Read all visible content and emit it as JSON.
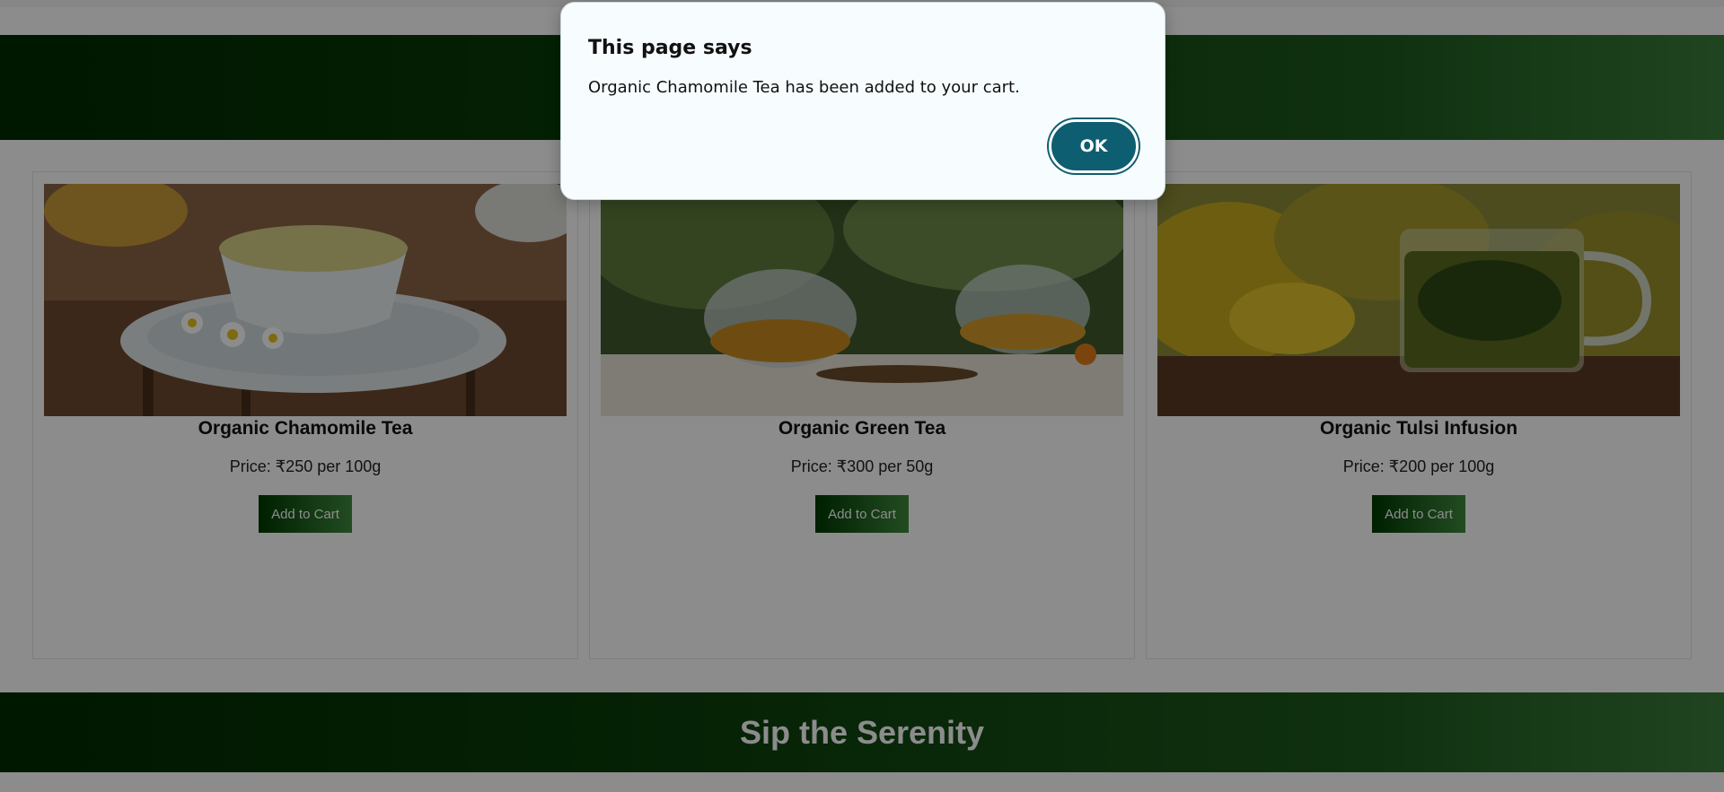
{
  "products": [
    {
      "name": "Organic Chamomile Tea",
      "price": "Price: ₹250 per 100g",
      "button": "Add to Cart",
      "image_icon": "chamomile-tea-image"
    },
    {
      "name": "Organic Green Tea",
      "price": "Price: ₹300 per 50g",
      "button": "Add to Cart",
      "image_icon": "green-tea-image"
    },
    {
      "name": "Organic Tulsi Infusion",
      "price": "Price: ₹200 per 100g",
      "button": "Add to Cart",
      "image_icon": "tulsi-infusion-image"
    }
  ],
  "footer": {
    "tagline": "Sip the Serenity"
  },
  "dialog": {
    "title": "This page says",
    "message": "Organic Chamomile Tea has been added to your cart.",
    "ok_label": "OK"
  },
  "colors": {
    "brand_dark": "#002b00",
    "brand_light": "#3a7d3a",
    "dialog_button": "#0d5e70",
    "dialog_bg": "#f7fdff"
  }
}
